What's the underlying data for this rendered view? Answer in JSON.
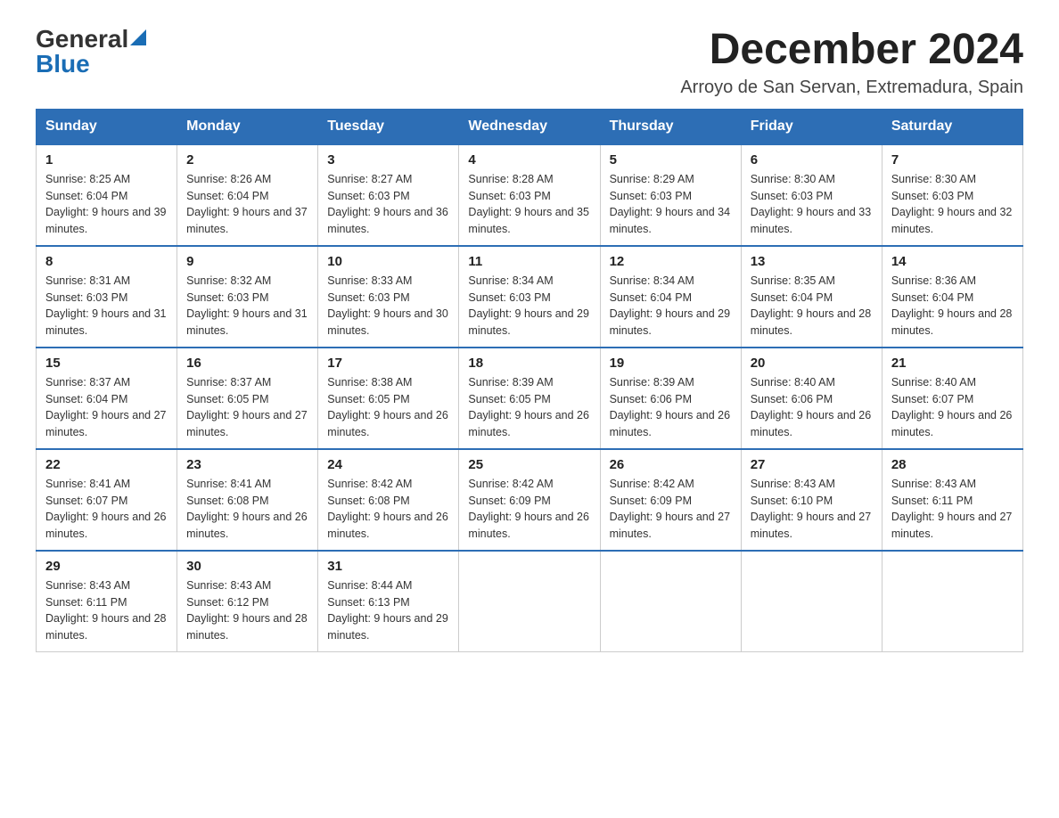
{
  "header": {
    "logo_general": "General",
    "logo_blue": "Blue",
    "month_title": "December 2024",
    "location": "Arroyo de San Servan, Extremadura, Spain"
  },
  "days_of_week": [
    "Sunday",
    "Monday",
    "Tuesday",
    "Wednesday",
    "Thursday",
    "Friday",
    "Saturday"
  ],
  "weeks": [
    [
      {
        "day": "1",
        "sunrise": "8:25 AM",
        "sunset": "6:04 PM",
        "daylight": "9 hours and 39 minutes."
      },
      {
        "day": "2",
        "sunrise": "8:26 AM",
        "sunset": "6:04 PM",
        "daylight": "9 hours and 37 minutes."
      },
      {
        "day": "3",
        "sunrise": "8:27 AM",
        "sunset": "6:03 PM",
        "daylight": "9 hours and 36 minutes."
      },
      {
        "day": "4",
        "sunrise": "8:28 AM",
        "sunset": "6:03 PM",
        "daylight": "9 hours and 35 minutes."
      },
      {
        "day": "5",
        "sunrise": "8:29 AM",
        "sunset": "6:03 PM",
        "daylight": "9 hours and 34 minutes."
      },
      {
        "day": "6",
        "sunrise": "8:30 AM",
        "sunset": "6:03 PM",
        "daylight": "9 hours and 33 minutes."
      },
      {
        "day": "7",
        "sunrise": "8:30 AM",
        "sunset": "6:03 PM",
        "daylight": "9 hours and 32 minutes."
      }
    ],
    [
      {
        "day": "8",
        "sunrise": "8:31 AM",
        "sunset": "6:03 PM",
        "daylight": "9 hours and 31 minutes."
      },
      {
        "day": "9",
        "sunrise": "8:32 AM",
        "sunset": "6:03 PM",
        "daylight": "9 hours and 31 minutes."
      },
      {
        "day": "10",
        "sunrise": "8:33 AM",
        "sunset": "6:03 PM",
        "daylight": "9 hours and 30 minutes."
      },
      {
        "day": "11",
        "sunrise": "8:34 AM",
        "sunset": "6:03 PM",
        "daylight": "9 hours and 29 minutes."
      },
      {
        "day": "12",
        "sunrise": "8:34 AM",
        "sunset": "6:04 PM",
        "daylight": "9 hours and 29 minutes."
      },
      {
        "day": "13",
        "sunrise": "8:35 AM",
        "sunset": "6:04 PM",
        "daylight": "9 hours and 28 minutes."
      },
      {
        "day": "14",
        "sunrise": "8:36 AM",
        "sunset": "6:04 PM",
        "daylight": "9 hours and 28 minutes."
      }
    ],
    [
      {
        "day": "15",
        "sunrise": "8:37 AM",
        "sunset": "6:04 PM",
        "daylight": "9 hours and 27 minutes."
      },
      {
        "day": "16",
        "sunrise": "8:37 AM",
        "sunset": "6:05 PM",
        "daylight": "9 hours and 27 minutes."
      },
      {
        "day": "17",
        "sunrise": "8:38 AM",
        "sunset": "6:05 PM",
        "daylight": "9 hours and 26 minutes."
      },
      {
        "day": "18",
        "sunrise": "8:39 AM",
        "sunset": "6:05 PM",
        "daylight": "9 hours and 26 minutes."
      },
      {
        "day": "19",
        "sunrise": "8:39 AM",
        "sunset": "6:06 PM",
        "daylight": "9 hours and 26 minutes."
      },
      {
        "day": "20",
        "sunrise": "8:40 AM",
        "sunset": "6:06 PM",
        "daylight": "9 hours and 26 minutes."
      },
      {
        "day": "21",
        "sunrise": "8:40 AM",
        "sunset": "6:07 PM",
        "daylight": "9 hours and 26 minutes."
      }
    ],
    [
      {
        "day": "22",
        "sunrise": "8:41 AM",
        "sunset": "6:07 PM",
        "daylight": "9 hours and 26 minutes."
      },
      {
        "day": "23",
        "sunrise": "8:41 AM",
        "sunset": "6:08 PM",
        "daylight": "9 hours and 26 minutes."
      },
      {
        "day": "24",
        "sunrise": "8:42 AM",
        "sunset": "6:08 PM",
        "daylight": "9 hours and 26 minutes."
      },
      {
        "day": "25",
        "sunrise": "8:42 AM",
        "sunset": "6:09 PM",
        "daylight": "9 hours and 26 minutes."
      },
      {
        "day": "26",
        "sunrise": "8:42 AM",
        "sunset": "6:09 PM",
        "daylight": "9 hours and 27 minutes."
      },
      {
        "day": "27",
        "sunrise": "8:43 AM",
        "sunset": "6:10 PM",
        "daylight": "9 hours and 27 minutes."
      },
      {
        "day": "28",
        "sunrise": "8:43 AM",
        "sunset": "6:11 PM",
        "daylight": "9 hours and 27 minutes."
      }
    ],
    [
      {
        "day": "29",
        "sunrise": "8:43 AM",
        "sunset": "6:11 PM",
        "daylight": "9 hours and 28 minutes."
      },
      {
        "day": "30",
        "sunrise": "8:43 AM",
        "sunset": "6:12 PM",
        "daylight": "9 hours and 28 minutes."
      },
      {
        "day": "31",
        "sunrise": "8:44 AM",
        "sunset": "6:13 PM",
        "daylight": "9 hours and 29 minutes."
      },
      null,
      null,
      null,
      null
    ]
  ]
}
